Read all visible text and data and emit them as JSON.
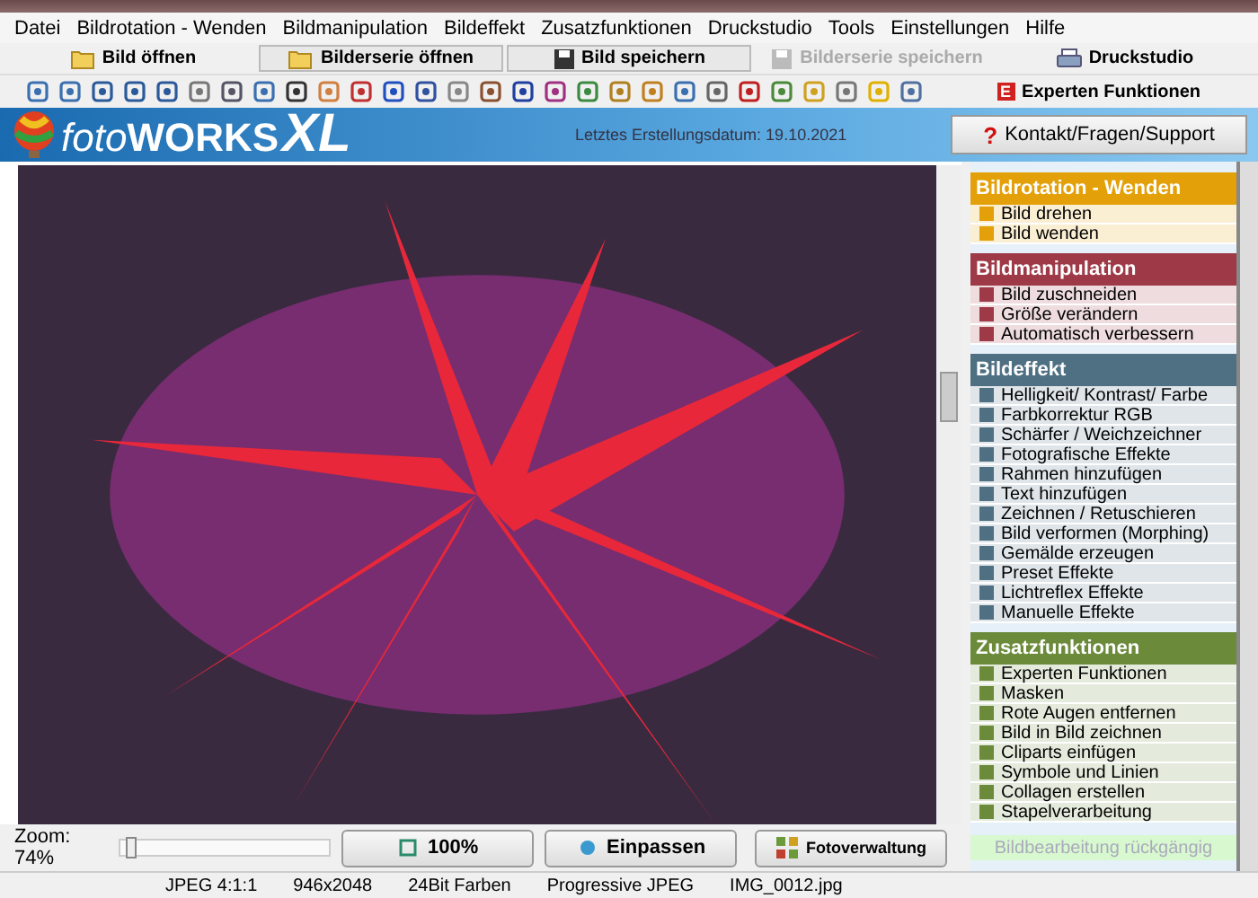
{
  "menu": [
    "Datei",
    "Bildrotation - Wenden",
    "Bildmanipulation",
    "Bildeffekt",
    "Zusatzfunktionen",
    "Druckstudio",
    "Tools",
    "Einstellungen",
    "Hilfe"
  ],
  "toolbar": [
    {
      "label": "Bild öffnen",
      "kind": "folder",
      "disabled": false
    },
    {
      "label": "Bilderserie öffnen",
      "kind": "folder",
      "disabled": false
    },
    {
      "label": "Bild speichern",
      "kind": "disk",
      "disabled": false
    },
    {
      "label": "Bilderserie speichern",
      "kind": "disk",
      "disabled": true
    },
    {
      "label": "Druckstudio",
      "kind": "printer",
      "disabled": false
    }
  ],
  "expert_button": {
    "badge": "E",
    "label": "Experten Funktionen"
  },
  "banner": {
    "logo_light": "foto",
    "logo_bold": "WORKS",
    "logo_big": "XL",
    "build_date": "Letztes Erstellungsdatum: 19.10.2021",
    "support_button": {
      "icon": "?",
      "label": "Kontakt/Fragen/Support"
    }
  },
  "sidebar": {
    "sections": [
      {
        "title": "Bildrotation - Wenden",
        "color": "#e3a008",
        "items": [
          "Bild drehen",
          "Bild wenden"
        ]
      },
      {
        "title": "Bildmanipulation",
        "color": "#9e3a48",
        "items": [
          "Bild zuschneiden",
          "Größe verändern",
          "Automatisch verbessern"
        ]
      },
      {
        "title": "Bildeffekt",
        "color": "#4f6f82",
        "items": [
          "Helligkeit/ Kontrast/ Farbe",
          "Farbkorrektur RGB",
          "Schärfer / Weichzeichner",
          "Fotografische Effekte",
          "Rahmen hinzufügen",
          "Text hinzufügen",
          "Zeichnen / Retuschieren",
          "Bild verformen (Morphing)",
          "Gemälde erzeugen",
          "Preset Effekte",
          "Lichtreflex Effekte",
          "Manuelle Effekte"
        ]
      },
      {
        "title": "Zusatzfunktionen",
        "color": "#6b8a3a",
        "items": [
          "Experten Funktionen",
          "Masken",
          "Rote Augen entfernen",
          "Bild in Bild zeichnen",
          "Cliparts einfügen",
          "Symbole und Linien",
          "Collagen erstellen",
          "Stapelverarbeitung"
        ]
      }
    ],
    "undo_button": {
      "label": "Bildbearbeitung rückgängig",
      "disabled": true
    }
  },
  "bottom_bar": {
    "zoom_label": "Zoom: 74%",
    "zoom_slider": {
      "level": 0.05
    },
    "buttons": [
      "100%",
      "Einpassen",
      "Fotoverwaltung"
    ]
  },
  "status_bar": [
    "JPEG 4:1:1",
    "946x2048",
    "24Bit Farben",
    "Progressive JPEG",
    "IMG_0012.jpg"
  ]
}
